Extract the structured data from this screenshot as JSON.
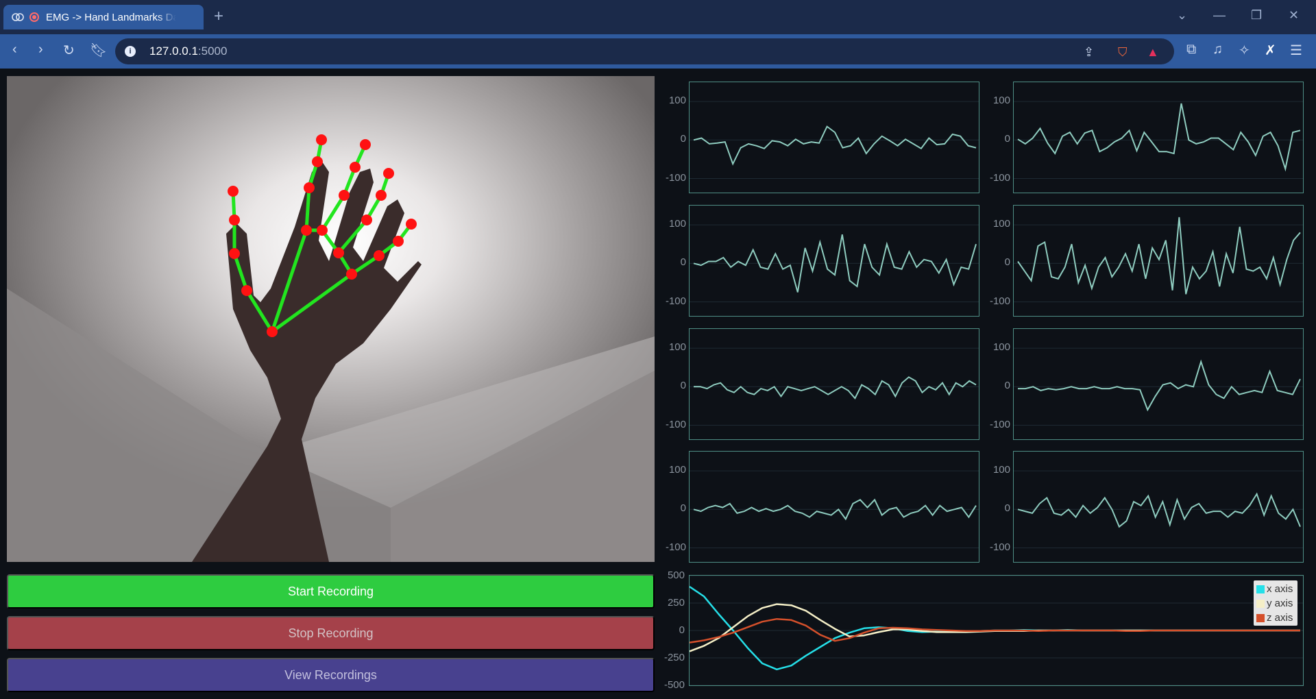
{
  "browser": {
    "tab_title": "EMG -> Hand Landmarks Data",
    "tab_close": "✕",
    "new_tab": "+",
    "url_host": "127.0.0.1",
    "url_port": ":5000"
  },
  "buttons": {
    "start": "Start Recording",
    "stop": "Stop Recording",
    "view": "View Recordings"
  },
  "emg": {
    "ylim": [
      -140,
      150
    ],
    "ticks": [
      "100",
      "0",
      "-100"
    ],
    "line_color": "#8fcdc0",
    "channels": [
      {
        "values": [
          0,
          5,
          -10,
          -8,
          -5,
          -62,
          -20,
          -10,
          -15,
          -22,
          -2,
          -5,
          -15,
          2,
          -10,
          -5,
          -8,
          35,
          20,
          -20,
          -15,
          5,
          -35,
          -10,
          10,
          -2,
          -15,
          2,
          -10,
          -22,
          5,
          -12,
          -10,
          15,
          10,
          -15,
          -20
        ]
      },
      {
        "values": [
          2,
          -10,
          5,
          30,
          -8,
          -35,
          10,
          20,
          -10,
          18,
          25,
          -30,
          -20,
          -5,
          5,
          25,
          -28,
          20,
          -5,
          -30,
          -30,
          -35,
          95,
          0,
          -10,
          -5,
          5,
          5,
          -10,
          -25,
          20,
          -5,
          -40,
          10,
          20,
          -15,
          -75,
          20,
          25
        ]
      },
      {
        "values": [
          0,
          -5,
          5,
          5,
          15,
          -10,
          5,
          -5,
          35,
          -10,
          -15,
          25,
          -15,
          -5,
          -75,
          40,
          -20,
          55,
          -15,
          -30,
          75,
          -45,
          -60,
          50,
          -10,
          -30,
          50,
          -10,
          -15,
          30,
          -10,
          10,
          5,
          -25,
          10,
          -55,
          -10,
          -15,
          50
        ]
      },
      {
        "values": [
          5,
          -20,
          -45,
          45,
          55,
          -35,
          -40,
          -10,
          50,
          -50,
          -5,
          -65,
          -10,
          15,
          -35,
          -10,
          25,
          -20,
          50,
          -40,
          40,
          10,
          60,
          -70,
          120,
          -80,
          -10,
          -40,
          -20,
          30,
          -60,
          25,
          -25,
          95,
          -15,
          -20,
          -10,
          -40,
          15,
          -55,
          10,
          60,
          80
        ]
      },
      {
        "values": [
          0,
          0,
          -5,
          5,
          10,
          -8,
          -15,
          0,
          -15,
          -20,
          -5,
          -10,
          0,
          -25,
          0,
          -5,
          -10,
          -5,
          0,
          -10,
          -20,
          -10,
          0,
          -10,
          -30,
          5,
          -5,
          -20,
          15,
          5,
          -25,
          10,
          25,
          15,
          -15,
          0,
          -8,
          10,
          -20,
          10,
          0,
          15,
          5
        ]
      },
      {
        "values": [
          -5,
          -5,
          0,
          -10,
          -5,
          -8,
          -5,
          0,
          -5,
          -5,
          0,
          -5,
          -5,
          0,
          -5,
          -5,
          -8,
          -60,
          -25,
          5,
          10,
          -5,
          5,
          0,
          65,
          5,
          -20,
          -30,
          0,
          -20,
          -15,
          -10,
          -15,
          40,
          -10,
          -15,
          -20,
          20
        ]
      },
      {
        "values": [
          0,
          -5,
          5,
          10,
          5,
          15,
          -10,
          -5,
          5,
          -5,
          2,
          -5,
          0,
          10,
          -5,
          -10,
          -20,
          -5,
          -10,
          -15,
          0,
          -25,
          15,
          25,
          5,
          25,
          -15,
          0,
          5,
          -20,
          -10,
          -5,
          10,
          -15,
          10,
          -5,
          0,
          5,
          -20,
          10
        ]
      },
      {
        "values": [
          0,
          -5,
          -10,
          15,
          30,
          -10,
          -15,
          0,
          -20,
          10,
          -10,
          5,
          30,
          0,
          -45,
          -30,
          20,
          10,
          35,
          -20,
          20,
          -40,
          25,
          -25,
          5,
          15,
          -10,
          -5,
          -5,
          -20,
          -5,
          -10,
          10,
          40,
          -15,
          35,
          -10,
          -25,
          0,
          -45
        ]
      }
    ]
  },
  "imu": {
    "ylim": [
      -500,
      500
    ],
    "ticks": [
      "500",
      "250",
      "0",
      "-250",
      "-500"
    ],
    "legend": [
      {
        "label": "x axis",
        "color": "#25dfe8"
      },
      {
        "label": "y axis",
        "color": "#f5efc7"
      },
      {
        "label": "z axis",
        "color": "#d5502b"
      }
    ],
    "series": [
      {
        "name": "x axis",
        "values": [
          400,
          310,
          150,
          0,
          -160,
          -300,
          -355,
          -320,
          -230,
          -150,
          -70,
          -20,
          20,
          30,
          20,
          -5,
          -15,
          -10,
          -5,
          -5,
          -5,
          0,
          0,
          5,
          0,
          0,
          5,
          0,
          0,
          0,
          0,
          0,
          0,
          0,
          0,
          0,
          0,
          0,
          0,
          0,
          0,
          0,
          0
        ]
      },
      {
        "name": "y axis",
        "values": [
          -190,
          -140,
          -70,
          30,
          130,
          205,
          240,
          230,
          180,
          95,
          15,
          -55,
          -45,
          -15,
          10,
          10,
          -5,
          -15,
          -15,
          -15,
          -10,
          -5,
          -5,
          -5,
          0,
          0,
          0,
          0,
          0,
          0,
          0,
          0,
          0,
          0,
          0,
          0,
          0,
          0,
          0,
          0,
          0,
          0,
          0
        ]
      },
      {
        "name": "z axis",
        "values": [
          -110,
          -90,
          -60,
          -20,
          30,
          80,
          105,
          95,
          45,
          -40,
          -95,
          -70,
          -20,
          20,
          25,
          20,
          10,
          5,
          0,
          -5,
          -5,
          0,
          0,
          0,
          -5,
          0,
          0,
          0,
          0,
          0,
          -5,
          -5,
          0,
          0,
          0,
          0,
          0,
          0,
          0,
          0,
          0,
          0,
          0
        ]
      }
    ]
  }
}
